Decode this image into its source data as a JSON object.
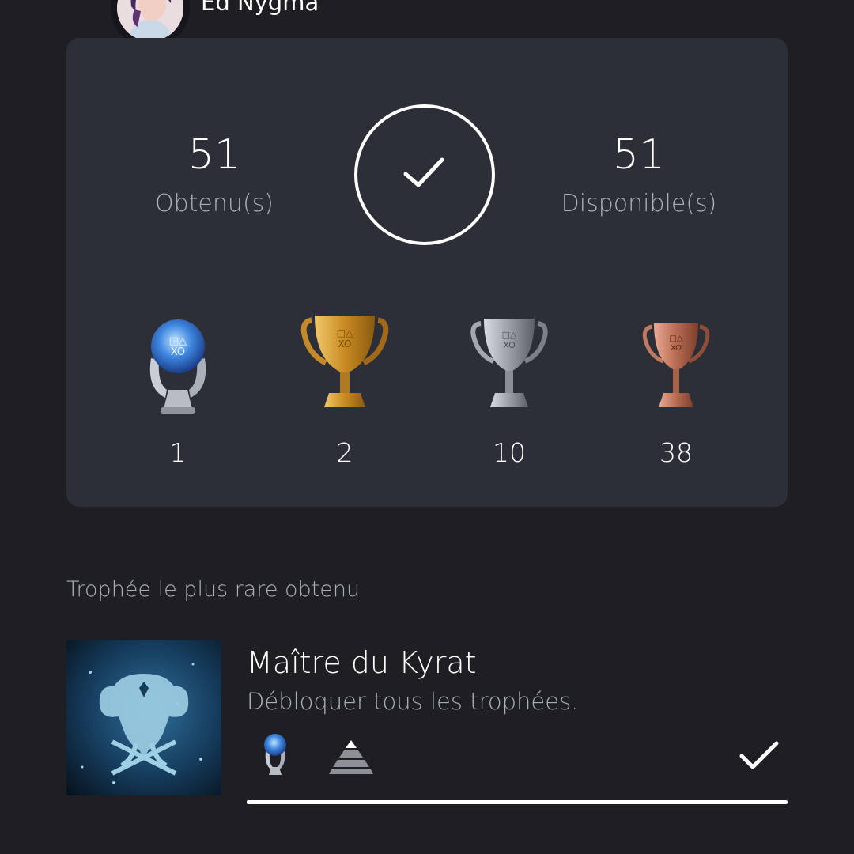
{
  "profile": {
    "username": "Ed Nygma"
  },
  "summary": {
    "earned": {
      "value": "51",
      "label": "Obtenu(s)"
    },
    "available": {
      "value": "51",
      "label": "Disponible(s)"
    },
    "completion_icon": "check-icon"
  },
  "trophies": [
    {
      "type": "platinum",
      "icon": "platinum-trophy-icon",
      "count": "1",
      "color": "#5ea6e6"
    },
    {
      "type": "gold",
      "icon": "gold-trophy-icon",
      "count": "2",
      "color": "#d6a23c"
    },
    {
      "type": "silver",
      "icon": "silver-trophy-icon",
      "count": "10",
      "color": "#9a9ea6"
    },
    {
      "type": "bronze",
      "icon": "bronze-trophy-icon",
      "count": "38",
      "color": "#c47a62"
    }
  ],
  "rarest": {
    "section_title": "Trophée le plus rare obtenu",
    "name": "Maître du Kyrat",
    "description": "Débloquer tous les trophées.",
    "grade_icon": "platinum-trophy-icon",
    "rarity_icon": "rarity-pyramid-icon",
    "status_icon": "check-icon",
    "progress": 1.0
  }
}
